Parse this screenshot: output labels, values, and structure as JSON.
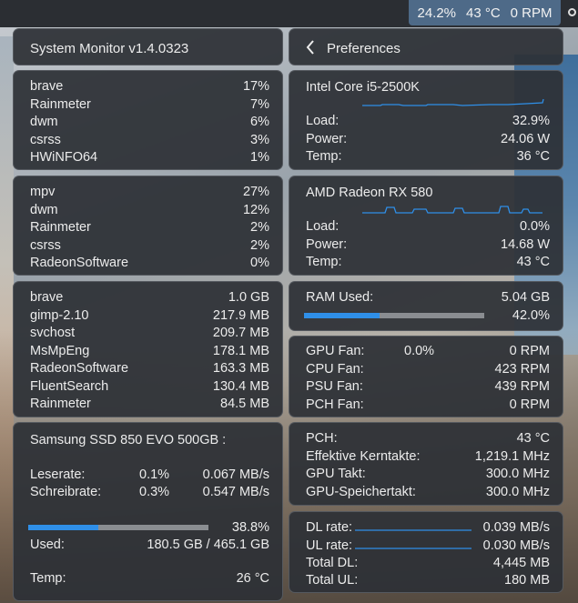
{
  "tray": {
    "cpu_load": "24.2%",
    "temp": "43 °C",
    "fan": "0 RPM"
  },
  "header": {
    "title": "System Monitor v1.4.0323",
    "back_icon": "chevron-left-icon",
    "preferences_label": "Preferences"
  },
  "cpu_processes": [
    {
      "name": "brave",
      "value": "17%"
    },
    {
      "name": "Rainmeter",
      "value": "7%"
    },
    {
      "name": "dwm",
      "value": "6%"
    },
    {
      "name": "csrss",
      "value": "3%"
    },
    {
      "name": "HWiNFO64",
      "value": "1%"
    }
  ],
  "gpu_processes": [
    {
      "name": "mpv",
      "value": "27%"
    },
    {
      "name": "dwm",
      "value": "12%"
    },
    {
      "name": "Rainmeter",
      "value": "2%"
    },
    {
      "name": "csrss",
      "value": "2%"
    },
    {
      "name": "RadeonSoftware",
      "value": "0%"
    }
  ],
  "mem_processes": [
    {
      "name": "brave",
      "value": "1.0 GB"
    },
    {
      "name": "gimp-2.10",
      "value": "217.9 MB"
    },
    {
      "name": "svchost",
      "value": "209.7 MB"
    },
    {
      "name": "MsMpEng",
      "value": "178.1 MB"
    },
    {
      "name": "RadeonSoftware",
      "value": "163.3 MB"
    },
    {
      "name": "FluentSearch",
      "value": "130.4 MB"
    },
    {
      "name": "Rainmeter",
      "value": "84.5 MB"
    }
  ],
  "cpu": {
    "name": "Intel Core i5-2500K",
    "load_label": "Load:",
    "load": "32.9%",
    "power_label": "Power:",
    "power": "24.06 W",
    "temp_label": "Temp:",
    "temp": "36 °C"
  },
  "gpu": {
    "name": "AMD Radeon RX 580",
    "load_label": "Load:",
    "load": "0.0%",
    "power_label": "Power:",
    "power": "14.68 W",
    "temp_label": "Temp:",
    "temp": "43 °C"
  },
  "ram": {
    "label": "RAM Used:",
    "used": "5.04 GB",
    "percent": "42.0%",
    "fraction": 0.42
  },
  "fans": [
    {
      "label": "GPU Fan:",
      "extra": "0.0%",
      "value": "0 RPM"
    },
    {
      "label": "CPU Fan:",
      "extra": "",
      "value": "423 RPM"
    },
    {
      "label": "PSU Fan:",
      "extra": "",
      "value": "439 RPM"
    },
    {
      "label": "PCH Fan:",
      "extra": "",
      "value": "0 RPM"
    }
  ],
  "disk": {
    "name": "Samsung SSD 850 EVO 500GB :",
    "read_label": "Leserate:",
    "read_pct": "0.1%",
    "read_rate": "0.067 MB/s",
    "write_label": "Schreibrate:",
    "write_pct": "0.3%",
    "write_rate": "0.547 MB/s",
    "usage_percent": "38.8%",
    "usage_fraction": 0.388,
    "used_label": "Used:",
    "used": "180.5 GB / 465.1 GB",
    "temp_label": "Temp:",
    "temp": "26 °C"
  },
  "sensors": [
    {
      "label": "PCH:",
      "value": "43 °C"
    },
    {
      "label": "Effektive Kerntakte:",
      "value": "1,219.1 MHz"
    },
    {
      "label": "GPU Takt:",
      "value": "300.0 MHz"
    },
    {
      "label": "GPU-Speichertakt:",
      "value": "300.0 MHz"
    }
  ],
  "network": {
    "dl_label": "DL rate:",
    "dl_rate": "0.039 MB/s",
    "ul_label": "UL rate:",
    "ul_rate": "0.030 MB/s",
    "total_dl_label": "Total DL:",
    "total_dl": "4,445 MB",
    "total_ul_label": "Total UL:",
    "total_ul": "180 MB"
  },
  "colors": {
    "accent": "#2f8fe8",
    "panel": "#2d3036",
    "tray": "#4e6a88"
  }
}
